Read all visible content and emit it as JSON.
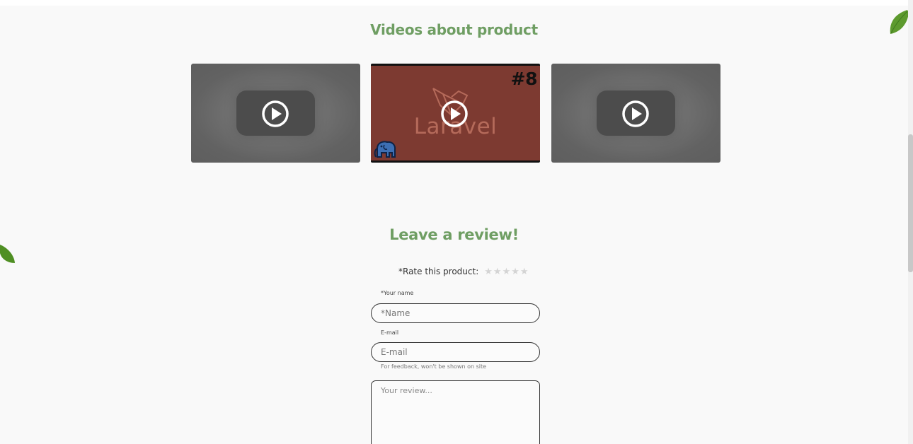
{
  "videos_section": {
    "title": "Videos about product",
    "videos": [
      {
        "kind": "placeholder",
        "icon": "play-icon"
      },
      {
        "kind": "thumbnail",
        "thumbnail_text": "Laravel",
        "episode": "#8",
        "icon": "play-icon"
      },
      {
        "kind": "placeholder",
        "icon": "play-icon"
      }
    ]
  },
  "review_section": {
    "title": "Leave a review!",
    "rate_label": "*Rate this product:",
    "stars": [
      "★",
      "★",
      "★",
      "★",
      "★"
    ],
    "name_label": "*Your name",
    "name_placeholder": "*Name",
    "email_label": "E-mail",
    "email_placeholder": "E-mail",
    "email_helper": "For feedback, won't be shown on site",
    "review_placeholder": "Your review..."
  },
  "colors": {
    "accent_green": "#6f9e63",
    "thumbnail_red": "#7d3a31",
    "star_empty": "#d4d4d4"
  }
}
